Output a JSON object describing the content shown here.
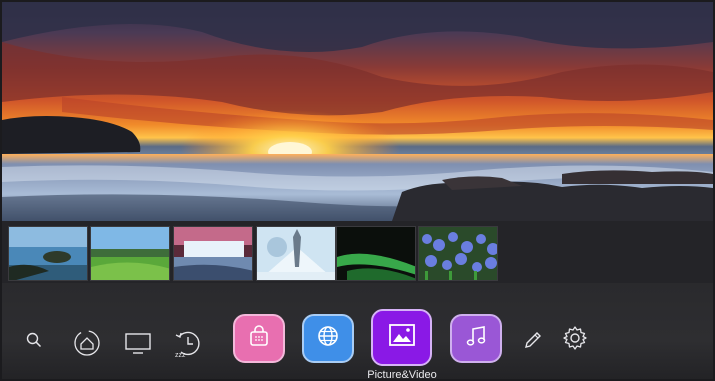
{
  "hero": {
    "image": "sunset over ocean with rocky shore"
  },
  "thumbnails": [
    {
      "name": "thumb-lake-island"
    },
    {
      "name": "thumb-green-landscape"
    },
    {
      "name": "thumb-waterfall"
    },
    {
      "name": "thumb-snowy-tree"
    },
    {
      "name": "thumb-green-abstract"
    },
    {
      "name": "thumb-blue-flowers"
    }
  ],
  "dock": {
    "left_icons": [
      "search-icon",
      "home-icon",
      "tv-input-icon",
      "sleep-timer-icon"
    ],
    "apps": [
      {
        "id": "store",
        "icon": "shopping-bag-icon",
        "color": "#e86fb0"
      },
      {
        "id": "browser",
        "icon": "globe-icon",
        "color": "#3f8fe8"
      },
      {
        "id": "picture",
        "icon": "image-icon",
        "color": "#8a19e6"
      },
      {
        "id": "music",
        "icon": "music-note-icon",
        "color": "#9a57d6"
      }
    ],
    "right_icons": [
      "pencil-icon",
      "gear-icon"
    ],
    "focused_caption": "Picture&Video",
    "timer_badge": "zzz"
  }
}
